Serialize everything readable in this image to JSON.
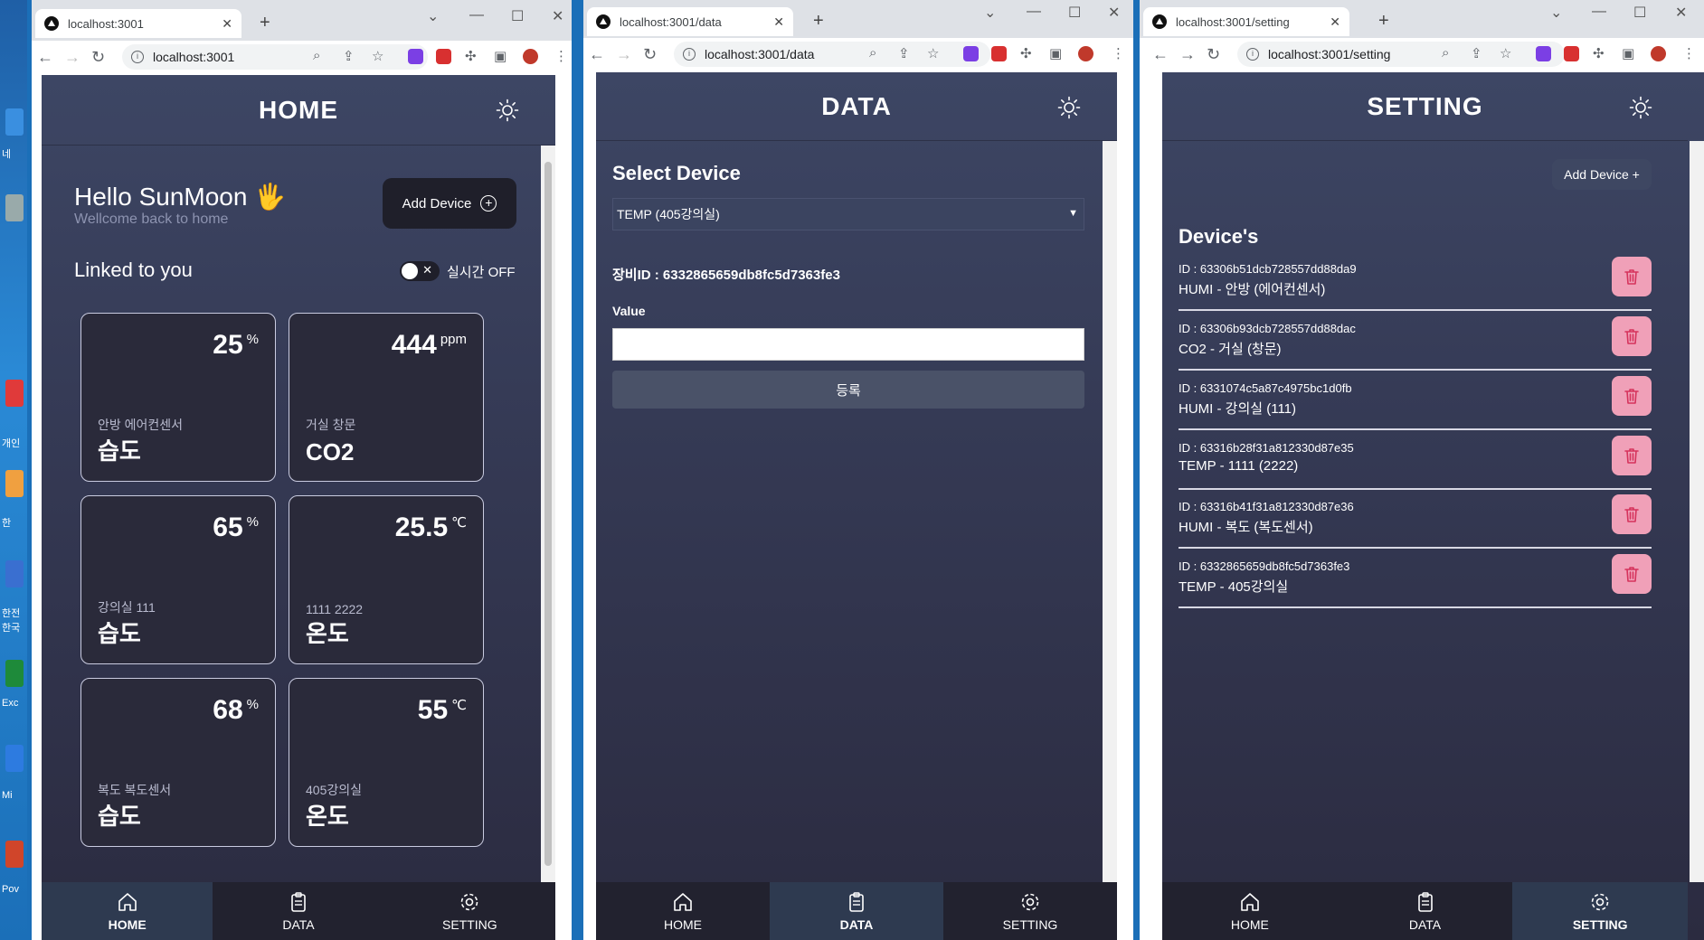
{
  "desktop": {
    "labels": [
      "네",
      "개인",
      "한",
      "한전",
      "한국",
      "Exc",
      "Mi",
      "Pov"
    ]
  },
  "windows": [
    {
      "tab_title": "localhost:3001",
      "url": "localhost:3001",
      "page_title": "HOME"
    },
    {
      "tab_title": "localhost:3001/data",
      "url": "localhost:3001/data",
      "page_title": "DATA"
    },
    {
      "tab_title": "localhost:3001/setting",
      "url": "localhost:3001/setting",
      "page_title": "SETTING"
    }
  ],
  "home": {
    "greeting": "Hello SunMoon",
    "greeting_emoji": "🖐",
    "subtitle": "Wellcome back to home",
    "add_device_label": "Add Device",
    "linked_title": "Linked to you",
    "realtime_label": "실시간  OFF",
    "cards": [
      {
        "value": "25",
        "unit": "%",
        "location": "안방 에어컨센서",
        "name": "습도"
      },
      {
        "value": "444",
        "unit": "ppm",
        "location": "거실 창문",
        "name": "CO2"
      },
      {
        "value": "65",
        "unit": "%",
        "location": "강의실 111",
        "name": "습도"
      },
      {
        "value": "25.5",
        "unit": "℃",
        "location": "1111 2222",
        "name": "온도"
      },
      {
        "value": "68",
        "unit": "%",
        "location": "복도 복도센서",
        "name": "습도"
      },
      {
        "value": "55",
        "unit": "℃",
        "location": "405강의실",
        "name": "온도"
      }
    ]
  },
  "data_page": {
    "select_title": "Select Device",
    "selected_device": "TEMP (405강의실)",
    "device_id_text": "장비ID : 6332865659db8fc5d7363fe3",
    "value_label": "Value",
    "value_input": "",
    "submit_label": "등록"
  },
  "setting_page": {
    "add_device_label": "Add Device +",
    "devices_title": "Device's",
    "devices": [
      {
        "id_text": "ID : 63306b51dcb728557dd88da9",
        "name_text": "HUMI - 안방 (에어컨센서)"
      },
      {
        "id_text": "ID : 63306b93dcb728557dd88dac",
        "name_text": "CO2 - 거실 (창문)"
      },
      {
        "id_text": "ID : 6331074c5a87c4975bc1d0fb",
        "name_text": "HUMI - 강의실 (111)"
      },
      {
        "id_text": "ID : 63316b28f31a812330d87e35",
        "name_text": "TEMP - 1111 (2222)"
      },
      {
        "id_text": "ID : 63316b41f31a812330d87e36",
        "name_text": "HUMI - 복도 (복도센서)"
      },
      {
        "id_text": "ID : 6332865659db8fc5d7363fe3",
        "name_text": "TEMP - 405강의실"
      }
    ]
  },
  "bottom_nav": {
    "home": "HOME",
    "data": "DATA",
    "setting": "SETTING"
  },
  "colors": {
    "app_bg_top": "#3d4664",
    "app_bg_bottom": "#2b2b40",
    "delete_button": "#f0a0b8",
    "delete_icon": "#d6335c",
    "active_nav": "#2e3a50"
  }
}
